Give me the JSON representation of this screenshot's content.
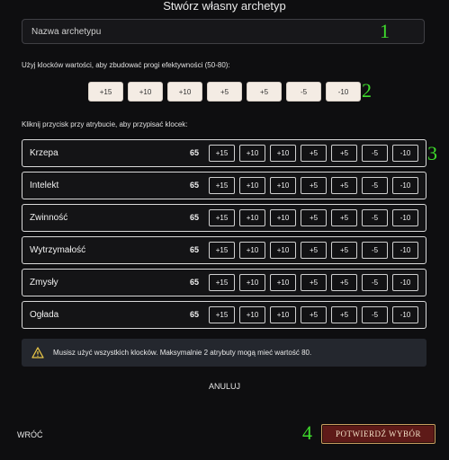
{
  "title": "Stwórz własny archetyp",
  "name_input": {
    "placeholder": "Nazwa archetypu",
    "value": ""
  },
  "annotations": [
    "1",
    "2",
    "3",
    "4"
  ],
  "chips_hint": "Użyj klocków wartości, aby zbudować progi efektywności (50-80):",
  "chips": [
    "+15",
    "+10",
    "+10",
    "+5",
    "+5",
    "-5",
    "-10"
  ],
  "attributes_hint": "Kliknij przycisk przy atrybucie, aby przypisać klocek:",
  "attribute_buttons": [
    "+15",
    "+10",
    "+10",
    "+5",
    "+5",
    "-5",
    "-10"
  ],
  "attributes": [
    {
      "name": "Krzepa",
      "value": "65"
    },
    {
      "name": "Intelekt",
      "value": "65"
    },
    {
      "name": "Zwinność",
      "value": "65"
    },
    {
      "name": "Wytrzymałość",
      "value": "65"
    },
    {
      "name": "Zmysły",
      "value": "65"
    },
    {
      "name": "Ogłada",
      "value": "65"
    }
  ],
  "warning": {
    "icon": "warning-triangle-icon",
    "text": "Musisz użyć wszystkich klocków. Maksymalnie 2 atrybuty mogą mieć wartość 80."
  },
  "cancel_label": "ANULUJ",
  "back_label": "WRÓĆ",
  "confirm_label": "POTWIERDŹ WYBÓR",
  "colors": {
    "accent_green": "#3edb2c",
    "confirm_bg": "#5e1a18",
    "confirm_border": "#c8a060",
    "chip_bg": "#f4ece4"
  }
}
